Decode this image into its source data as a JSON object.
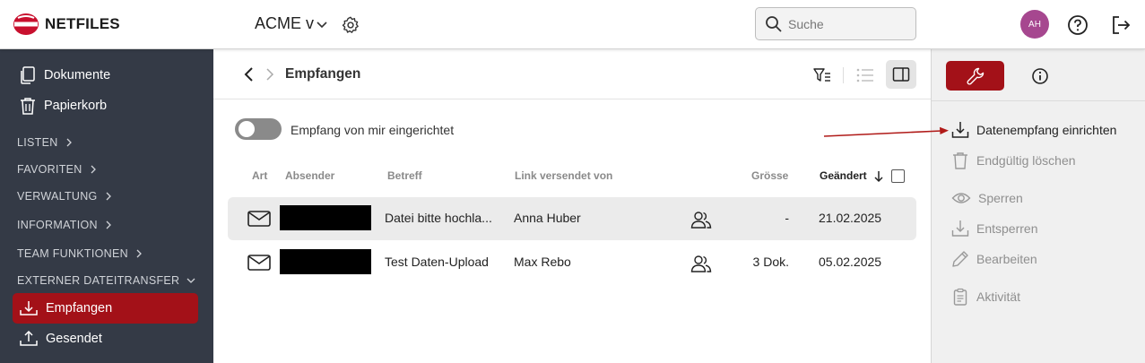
{
  "header": {
    "logo_text": "NETFILES",
    "workspace": "ACME v",
    "search_placeholder": "Suche",
    "avatar_initials": "AH"
  },
  "sidebar": {
    "items_top": [
      {
        "label": "Dokumente",
        "icon": "documents-icon"
      },
      {
        "label": "Papierkorb",
        "icon": "trash-icon"
      }
    ],
    "sections": [
      {
        "label": "LISTEN",
        "expanded": false
      },
      {
        "label": "FAVORITEN",
        "expanded": false
      },
      {
        "label": "VERWALTUNG",
        "expanded": false
      },
      {
        "label": "INFORMATION",
        "expanded": false
      },
      {
        "label": "TEAM FUNKTIONEN",
        "expanded": false
      },
      {
        "label": "EXTERNER DATEITRANSFER",
        "expanded": true
      }
    ],
    "transfer_items": [
      {
        "label": "Empfangen",
        "icon": "receive-icon",
        "active": true
      },
      {
        "label": "Gesendet",
        "icon": "send-icon",
        "active": false
      }
    ]
  },
  "content": {
    "breadcrumb_title": "Empfangen",
    "toggle_label": "Empfang von mir eingerichtet",
    "toggle_on": false,
    "columns": {
      "art": "Art",
      "absender": "Absender",
      "betreff": "Betreff",
      "link": "Link versendet von",
      "groesse": "Grösse",
      "geaendert": "Geändert"
    },
    "rows": [
      {
        "betreff": "Datei bitte hochla...",
        "link_by": "Anna Huber",
        "groesse": "-",
        "geaendert": "21.02.2025",
        "selected": true
      },
      {
        "betreff": "Test Daten-Upload",
        "link_by": "Max Rebo",
        "groesse": "3 Dok.",
        "geaendert": "05.02.2025",
        "selected": false
      }
    ]
  },
  "right_panel": {
    "actions": [
      {
        "label": "Datenempfang einrichten",
        "icon": "download-tray-icon",
        "enabled": true
      },
      {
        "label": "Endgültig löschen",
        "icon": "trash-icon",
        "enabled": false
      },
      {
        "label": "Sperren",
        "icon": "eye-icon",
        "enabled": false
      },
      {
        "label": "Entsperren",
        "icon": "download-arrow-icon",
        "enabled": false
      },
      {
        "label": "Bearbeiten",
        "icon": "pencil-icon",
        "enabled": false
      },
      {
        "label": "Aktivität",
        "icon": "clipboard-icon",
        "enabled": false
      }
    ]
  },
  "colors": {
    "brand_red": "#a31118",
    "sidebar_bg": "#343a46",
    "avatar_bg": "#a6478f",
    "annotation_arrow": "#b01a18"
  }
}
